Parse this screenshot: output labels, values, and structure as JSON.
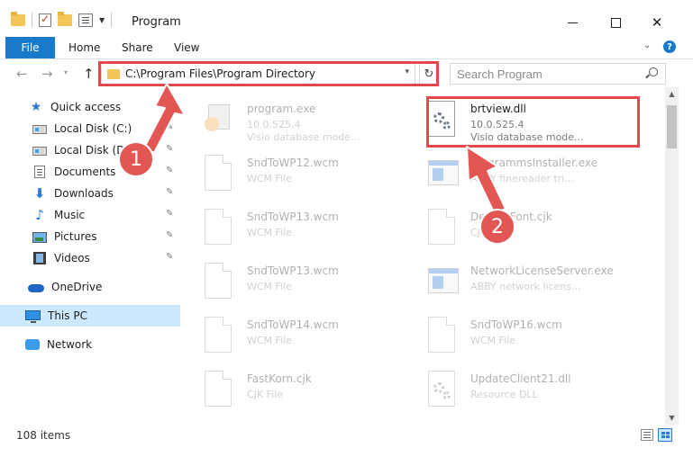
{
  "window": {
    "title": "Program",
    "minimize_icon": "minimize-icon",
    "maximize_icon": "maximize-icon",
    "close_symbol": "✕"
  },
  "ribbon": {
    "tabs": [
      "File",
      "Home",
      "Share",
      "View"
    ],
    "help_symbol": "?"
  },
  "nav": {
    "back_symbol": "←",
    "forward_symbol": "→",
    "recent_symbol": "▾",
    "up_symbol": "↑",
    "address": "C:\\Program Files\\Program Directory",
    "dropdown_symbol": "▾",
    "refresh_symbol": "↻",
    "search_placeholder": "Search Program"
  },
  "sidebar": {
    "items": [
      {
        "label": "Quick access",
        "icon": "star-icon",
        "pinned": false
      },
      {
        "label": "Local Disk (C:)",
        "icon": "disk-icon",
        "pinned": true
      },
      {
        "label": "Local Disk (D:)",
        "icon": "disk-icon",
        "pinned": true
      },
      {
        "label": "Documents",
        "icon": "documents-icon",
        "pinned": true
      },
      {
        "label": "Downloads",
        "icon": "downloads-icon",
        "pinned": true
      },
      {
        "label": "Music",
        "icon": "music-icon",
        "pinned": true
      },
      {
        "label": "Pictures",
        "icon": "pictures-icon",
        "pinned": true
      },
      {
        "label": "Videos",
        "icon": "videos-icon",
        "pinned": true
      },
      {
        "label": "OneDrive",
        "icon": "onedrive-icon",
        "pinned": false
      },
      {
        "label": "This PC",
        "icon": "this-pc-icon",
        "pinned": false,
        "selected": true
      },
      {
        "label": "Network",
        "icon": "network-icon",
        "pinned": false
      }
    ],
    "pin_symbol": "📌"
  },
  "files": [
    {
      "name": "program.exe",
      "line1": "10.0.525.4",
      "line2": "Visio database mode...",
      "icon": "program-icon"
    },
    {
      "name": "brtview.dll",
      "line1": "10.0.525.4",
      "line2": "Visio database mode...",
      "icon": "dll-gear-icon",
      "highlighted": true
    },
    {
      "name": "SndToWP12.wcm",
      "line1": "WCM File",
      "line2": "",
      "icon": "file-icon"
    },
    {
      "name": "ProgrammsInstaller.exe",
      "line1": "ABBY finereader tri...",
      "line2": "",
      "icon": "exe-icon"
    },
    {
      "name": "SndToWP13.wcm",
      "line1": "WCM File",
      "line2": "",
      "icon": "file-icon"
    },
    {
      "name": "DefaultFont.cjk",
      "line1": "CJK File",
      "line2": "",
      "icon": "file-icon"
    },
    {
      "name": "SndToWP13.wcm",
      "line1": "WCM File",
      "line2": "",
      "icon": "file-icon"
    },
    {
      "name": "NetworkLicenseServer.exe",
      "line1": "ABBY network licens...",
      "line2": "",
      "icon": "exe-icon"
    },
    {
      "name": "SndToWP14.wcm",
      "line1": "WCM File",
      "line2": "",
      "icon": "file-icon"
    },
    {
      "name": "SndToWP16.wcm",
      "line1": "WCM File",
      "line2": "",
      "icon": "file-icon"
    },
    {
      "name": "FastKorn.cjk",
      "line1": "CJK File",
      "line2": "",
      "icon": "file-icon"
    },
    {
      "name": "UpdateClient21.dll",
      "line1": "Resource DLL",
      "line2": "",
      "icon": "dll-gear-icon"
    }
  ],
  "status": {
    "item_count": "108 items"
  },
  "annotations": {
    "step1": "1",
    "step2": "2",
    "color": "#e0484b"
  }
}
